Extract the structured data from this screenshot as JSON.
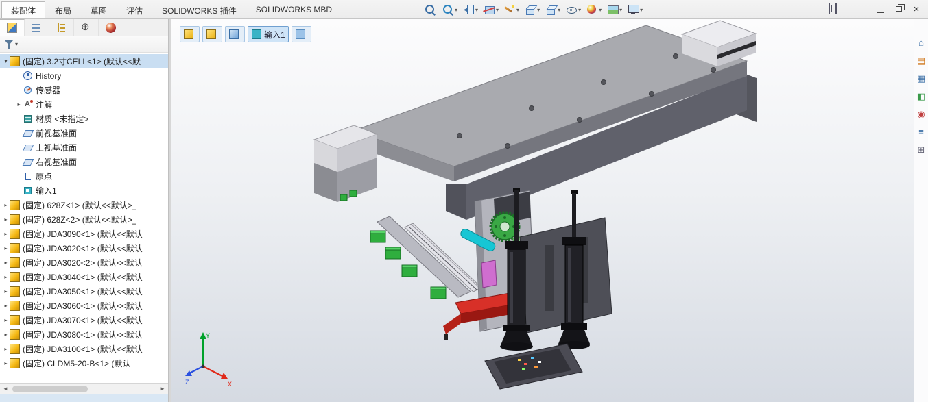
{
  "header": {
    "tabs": [
      {
        "name": "tab-assembly",
        "label": "装配体",
        "state": "tab-active"
      },
      {
        "name": "tab-layout",
        "label": "布局",
        "state": ""
      },
      {
        "name": "tab-sketch",
        "label": "草图",
        "state": ""
      },
      {
        "name": "tab-evaluate",
        "label": "评估",
        "state": ""
      },
      {
        "name": "tab-solidworks-addins",
        "label": "SOLIDWORKS 插件",
        "state": ""
      },
      {
        "name": "tab-solidworks-mbd",
        "label": "SOLIDWORKS MBD",
        "state": ""
      }
    ],
    "headsup": [
      {
        "name": "zoom-to-fit-button",
        "icon": "i-zoomfit",
        "dd": ""
      },
      {
        "name": "zoom-to-area-button",
        "icon": "i-zoomarea",
        "dd": "▾"
      },
      {
        "name": "previous-view-button",
        "icon": "i-prev",
        "dd": "▾"
      },
      {
        "name": "section-view-button",
        "icon": "i-section",
        "dd": "▾"
      },
      {
        "name": "annotation-view-button",
        "icon": "i-wand",
        "dd": "▾"
      },
      {
        "name": "view-orientation-button",
        "icon": "i-cube3d",
        "dd": "▾"
      },
      {
        "name": "display-style-button",
        "icon": "i-cube3d",
        "dd": "▾"
      },
      {
        "name": "hide-show-items-button",
        "icon": "i-eye",
        "dd": "▾"
      },
      {
        "name": "edit-appearance-button",
        "icon": "i-ball",
        "dd": "▾"
      },
      {
        "name": "apply-scene-button",
        "icon": "i-scene",
        "dd": "▾"
      },
      {
        "name": "view-settings-button",
        "icon": "i-monitor",
        "dd": "▾"
      }
    ],
    "window_controls": {
      "close_glyph": "×"
    }
  },
  "left_panel": {
    "manager_tabs": [
      {
        "name": "featuremanager-tab",
        "icon": "mt-fm",
        "state": "mtab-active"
      },
      {
        "name": "propertymanager-tab",
        "icon": "mt-pm",
        "state": ""
      },
      {
        "name": "configurationmanager-tab",
        "icon": "mt-cm",
        "state": ""
      },
      {
        "name": "dimxpertmanager-tab",
        "icon": "mt-dx",
        "state": ""
      },
      {
        "name": "displaymanager-tab",
        "icon": "mt-dm",
        "state": ""
      }
    ],
    "overflow_glyph": "▸",
    "filter_glyph": "▾",
    "tree": {
      "items": [
        {
          "label": "(固定) 3.2寸CELL<1> (默认<<默",
          "icon": "ic-assembly",
          "row_class": "lvl0 selected",
          "arrow": "▾"
        },
        {
          "label": "History",
          "icon": "ic-history",
          "row_class": "lvl1",
          "arrow": ""
        },
        {
          "label": "传感器",
          "icon": "ic-sensors",
          "row_class": "lvl1",
          "arrow": ""
        },
        {
          "label": "注解",
          "icon": "ic-annotations",
          "row_class": "lvl1",
          "arrow": "▸"
        },
        {
          "label": "材质 <未指定>",
          "icon": "ic-material",
          "row_class": "lvl1",
          "arrow": ""
        },
        {
          "label": "前视基准面",
          "icon": "ic-plane",
          "row_class": "lvl1",
          "arrow": ""
        },
        {
          "label": "上视基准面",
          "icon": "ic-plane",
          "row_class": "lvl1",
          "arrow": ""
        },
        {
          "label": "右视基准面",
          "icon": "ic-plane",
          "row_class": "lvl1",
          "arrow": ""
        },
        {
          "label": "原点",
          "icon": "ic-origin",
          "row_class": "lvl1",
          "arrow": ""
        },
        {
          "label": "输入1",
          "icon": "ic-import",
          "row_class": "lvl1",
          "arrow": ""
        },
        {
          "label": "(固定) 628Z<1> (默认<<默认>_",
          "icon": "ic-assembly",
          "row_class": "lvl0",
          "arrow": "▸"
        },
        {
          "label": "(固定) 628Z<2> (默认<<默认>_",
          "icon": "ic-assembly",
          "row_class": "lvl0",
          "arrow": "▸"
        },
        {
          "label": "(固定) JDA3090<1> (默认<<默认",
          "icon": "ic-assembly",
          "row_class": "lvl0",
          "arrow": "▸"
        },
        {
          "label": "(固定) JDA3020<1> (默认<<默认",
          "icon": "ic-assembly",
          "row_class": "lvl0",
          "arrow": "▸"
        },
        {
          "label": "(固定) JDA3020<2> (默认<<默认",
          "icon": "ic-assembly",
          "row_class": "lvl0",
          "arrow": "▸"
        },
        {
          "label": "(固定) JDA3040<1> (默认<<默认",
          "icon": "ic-assembly",
          "row_class": "lvl0",
          "arrow": "▸"
        },
        {
          "label": "(固定) JDA3050<1> (默认<<默认",
          "icon": "ic-assembly",
          "row_class": "lvl0",
          "arrow": "▸"
        },
        {
          "label": "(固定) JDA3060<1> (默认<<默认",
          "icon": "ic-assembly",
          "row_class": "lvl0",
          "arrow": "▸"
        },
        {
          "label": "(固定) JDA3070<1> (默认<<默认",
          "icon": "ic-assembly",
          "row_class": "lvl0",
          "arrow": "▸"
        },
        {
          "label": "(固定) JDA3080<1> (默认<<默认",
          "icon": "ic-assembly",
          "row_class": "lvl0",
          "arrow": "▸"
        },
        {
          "label": "(固定) JDA3100<1> (默认<<默认",
          "icon": "ic-assembly",
          "row_class": "lvl0",
          "arrow": "▸"
        },
        {
          "label": "(固定) CLDM5-20-B<1> (默认",
          "icon": "ic-assembly",
          "row_class": "lvl0",
          "arrow": "▸"
        }
      ]
    },
    "scroll": {
      "left_glyph": "◄",
      "right_glyph": "►"
    }
  },
  "breadcrumb": {
    "items": [
      {
        "name": "breadcrumb-assembly-icon-1",
        "icon": "bc-asm",
        "label": "",
        "chip": ""
      },
      {
        "name": "breadcrumb-assembly-icon-2",
        "icon": "bc-asm",
        "label": "",
        "chip": ""
      },
      {
        "name": "breadcrumb-part-icon",
        "icon": "bc-part",
        "label": "",
        "chip": ""
      },
      {
        "name": "breadcrumb-feature-chip",
        "icon": "bc-feature",
        "label": "输入1",
        "chip": "chip-active"
      },
      {
        "name": "breadcrumb-body-icon",
        "icon": "bc-body",
        "label": "",
        "chip": ""
      }
    ]
  },
  "taskpane": {
    "icons": [
      {
        "name": "solidworks-resources-icon",
        "glyph": "⌂",
        "cls": "c-blue"
      },
      {
        "name": "design-library-icon",
        "glyph": "▤",
        "cls": "c-orange"
      },
      {
        "name": "file-explorer-icon",
        "glyph": "▦",
        "cls": "c-blue"
      },
      {
        "name": "view-palette-icon",
        "glyph": "◧",
        "cls": "c-green"
      },
      {
        "name": "appearances-icon",
        "glyph": "◉",
        "cls": "c-red"
      },
      {
        "name": "custom-properties-icon",
        "glyph": "≡",
        "cls": "c-blue"
      },
      {
        "name": "forum-icon",
        "glyph": "⊞",
        "cls": "c-gray"
      }
    ]
  },
  "viewport": {
    "triad": {
      "x": "X",
      "y": "Y",
      "z": "Z"
    }
  }
}
